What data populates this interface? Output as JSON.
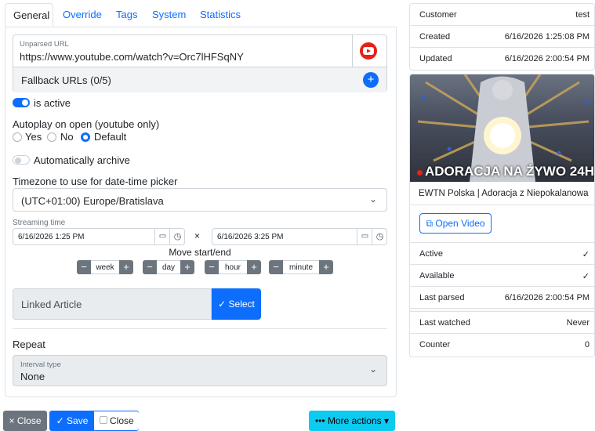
{
  "tabs": [
    "General",
    "Override",
    "Tags",
    "System",
    "Statistics"
  ],
  "url": {
    "label": "Unparsed URL",
    "value": "https://www.youtube.com/watch?v=Orc7lHFSqNY",
    "fallback": "Fallback URLs (0/5)"
  },
  "active": {
    "label": "is active",
    "on": true
  },
  "autoplay": {
    "label": "Autoplay on open (youtube only)",
    "options": [
      "Yes",
      "No",
      "Default"
    ],
    "selected": "Default"
  },
  "archive": {
    "label": "Automatically archive",
    "on": false
  },
  "timezone": {
    "label": "Timezone to use for date-time picker",
    "value": "(UTC+01:00) Europe/Bratislava"
  },
  "streaming": {
    "label": "Streaming time",
    "start": "6/16/2026 1:25 PM",
    "end": "6/16/2026 3:25 PM",
    "separator": "×",
    "move_label": "Move start/end",
    "units": [
      "week",
      "day",
      "hour",
      "minute"
    ],
    "minus": "−",
    "plus": "+"
  },
  "linked_article": {
    "placeholder": "Linked Article",
    "select": "Select"
  },
  "repeat": {
    "label": "Repeat",
    "interval_label": "Interval type",
    "interval_value": "None"
  },
  "footer": {
    "close": "Close",
    "save": "Save",
    "close_check": "Close",
    "more": "More actions"
  },
  "info": {
    "rows1": [
      {
        "k": "Customer",
        "v": "test"
      },
      {
        "k": "Created",
        "v": "6/16/2026 1:25:08 PM"
      },
      {
        "k": "Updated",
        "v": "6/16/2026 2:00:54 PM"
      }
    ],
    "thumb_text": "ADORACJA NA ŻYWO 24H",
    "video_title": "EWTN Polska | Adoracja z Niepokalanowa",
    "open_video": "Open Video",
    "rows2": [
      {
        "k": "Active",
        "v": "✓"
      },
      {
        "k": "Available",
        "v": "✓"
      },
      {
        "k": "Last parsed",
        "v": "6/16/2026 2:00:54 PM"
      }
    ],
    "rows3": [
      {
        "k": "Last watched",
        "v": "Never"
      },
      {
        "k": "Counter",
        "v": "0"
      }
    ]
  },
  "colors": {
    "primary": "#0d6efd",
    "info": "#0dcaf0",
    "secondary": "#6c757d",
    "youtube": "#e62117"
  }
}
